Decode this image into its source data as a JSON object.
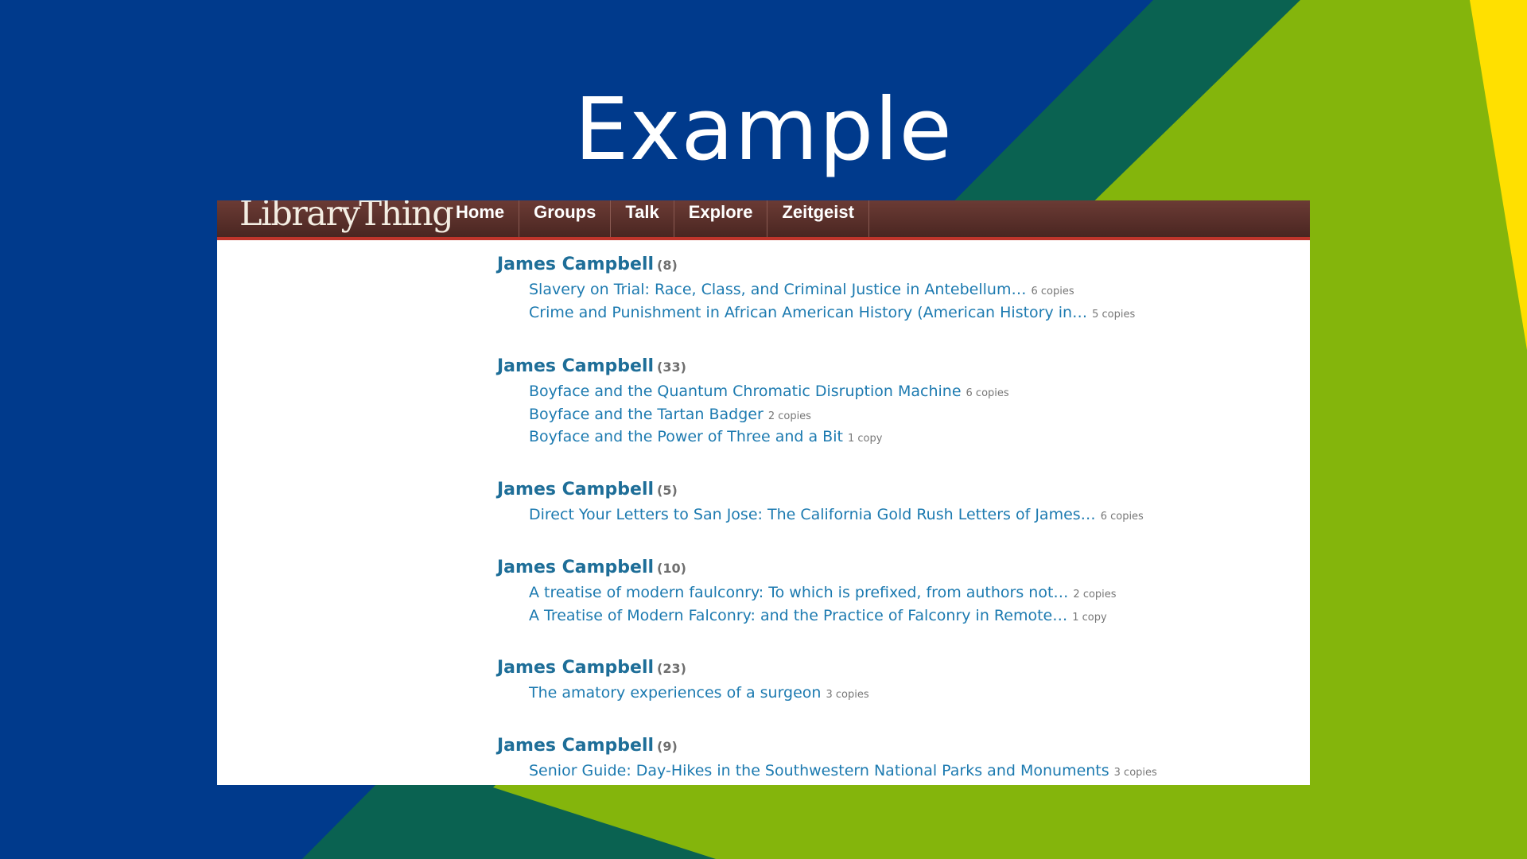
{
  "slide": {
    "title": "Example",
    "colors": {
      "blue": "#003a8c",
      "teal": "#0a6251",
      "green": "#84b50c",
      "yellow": "#ffe000"
    }
  },
  "app": {
    "logo": "LibraryThing",
    "nav": [
      "Home",
      "Groups",
      "Talk",
      "Explore",
      "Zeitgeist"
    ],
    "colors": {
      "navbar": "#5a2f2a",
      "accent_border": "#c0352b",
      "link": "#1c7ab0",
      "author": "#1e6e98"
    }
  },
  "authors": [
    {
      "name": "James Campbell",
      "count": "(8)",
      "works": [
        {
          "title": "Slavery on Trial: Race, Class, and Criminal Justice in Antebellum…",
          "copies": "6 copies"
        },
        {
          "title": "Crime and Punishment in African American History (American History in…",
          "copies": "5 copies"
        }
      ]
    },
    {
      "name": "James Campbell",
      "count": "(33)",
      "works": [
        {
          "title": "Boyface and the Quantum Chromatic Disruption Machine",
          "copies": "6 copies"
        },
        {
          "title": "Boyface and the Tartan Badger",
          "copies": "2 copies"
        },
        {
          "title": "Boyface and the Power of Three and a Bit",
          "copies": "1 copy"
        }
      ]
    },
    {
      "name": "James Campbell",
      "count": "(5)",
      "works": [
        {
          "title": "Direct Your Letters to San Jose: The California Gold Rush Letters of James…",
          "copies": "6 copies"
        }
      ]
    },
    {
      "name": "James Campbell",
      "count": "(10)",
      "works": [
        {
          "title": "A treatise of modern faulconry: To which is prefixed, from authors not…",
          "copies": "2 copies"
        },
        {
          "title": "A Treatise of Modern Falconry: and the Practice of Falconry in Remote…",
          "copies": "1 copy"
        }
      ]
    },
    {
      "name": "James Campbell",
      "count": "(23)",
      "works": [
        {
          "title": "The amatory experiences of a surgeon",
          "copies": "3 copies"
        }
      ]
    },
    {
      "name": "James Campbell",
      "count": "(9)",
      "works": [
        {
          "title": "Senior Guide: Day-Hikes in the Southwestern National Parks and Monuments",
          "copies": "3 copies"
        }
      ]
    }
  ]
}
